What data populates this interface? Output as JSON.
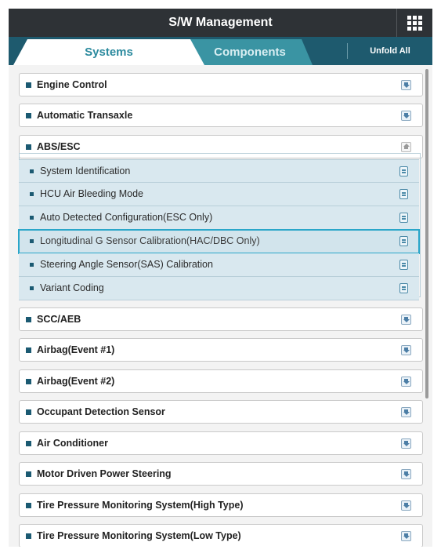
{
  "header": {
    "title": "S/W Management",
    "grid_icon": "grid-menu-icon"
  },
  "tabs": [
    {
      "label": "Systems",
      "active": true
    },
    {
      "label": "Components",
      "active": false
    }
  ],
  "unfold_all_label": "Unfold All",
  "systems_before": [
    {
      "label": "Engine Control",
      "icon": "download-icon"
    },
    {
      "label": "Automatic Transaxle",
      "icon": "download-icon"
    },
    {
      "label": "ABS/ESC",
      "icon": "collapse-icon",
      "expanded": true
    }
  ],
  "abs_sub_items": [
    {
      "label": "System Identification"
    },
    {
      "label": "HCU Air Bleeding Mode"
    },
    {
      "label": "Auto Detected Configuration(ESC Only)"
    },
    {
      "label": "Longitudinal G Sensor Calibration(HAC/DBC Only)",
      "selected": true
    },
    {
      "label": "Steering Angle Sensor(SAS) Calibration"
    },
    {
      "label": "Variant Coding"
    }
  ],
  "systems_after": [
    {
      "label": "SCC/AEB"
    },
    {
      "label": "Airbag(Event #1)"
    },
    {
      "label": "Airbag(Event #2)"
    },
    {
      "label": "Occupant Detection Sensor"
    },
    {
      "label": "Air Conditioner"
    },
    {
      "label": "Motor Driven Power Steering"
    },
    {
      "label": "Tire Pressure Monitoring System(High Type)"
    },
    {
      "label": "Tire Pressure Monitoring System(Low Type)"
    }
  ],
  "colors": {
    "title_bg": "#2e3236",
    "tab_bar": "#1e5a6e",
    "accent": "#2b8a9e",
    "selected_outline": "#2aa6c9",
    "sub_bg": "#d9e8ef"
  }
}
